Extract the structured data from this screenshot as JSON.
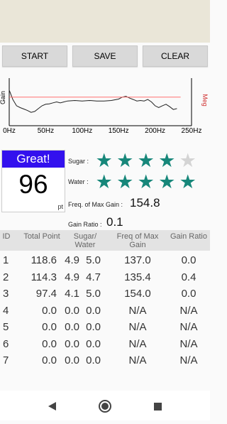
{
  "buttons": {
    "start": "START",
    "save": "SAVE",
    "clear": "CLEAR"
  },
  "chart_data": {
    "type": "line",
    "xlabel": "",
    "ylabel": "Gain",
    "ylabel_right": "Meg",
    "xlim": [
      0,
      250
    ],
    "x_ticks": [
      "0Hz",
      "50Hz",
      "100Hz",
      "150Hz",
      "200Hz",
      "250Hz"
    ],
    "series": [
      {
        "color": "#222222",
        "x": [
          0,
          5,
          10,
          15,
          20,
          25,
          30,
          35,
          40,
          45,
          50,
          55,
          60,
          65,
          70,
          75,
          80,
          90,
          100,
          110,
          120,
          130,
          140,
          150,
          155,
          160,
          165,
          170,
          175,
          180,
          185,
          190,
          195,
          200,
          205,
          210,
          215,
          220,
          225,
          230
        ],
        "y": [
          0.75,
          0.55,
          0.42,
          0.38,
          0.35,
          0.32,
          0.28,
          0.3,
          0.36,
          0.42,
          0.45,
          0.46,
          0.48,
          0.5,
          0.48,
          0.5,
          0.52,
          0.53,
          0.52,
          0.53,
          0.52,
          0.52,
          0.53,
          0.56,
          0.6,
          0.62,
          0.58,
          0.55,
          0.52,
          0.53,
          0.52,
          0.55,
          0.5,
          0.42,
          0.38,
          0.42,
          0.45,
          0.4,
          0.34,
          0.36
        ]
      },
      {
        "color": "#ff6f6f",
        "x": [
          0,
          235
        ],
        "y": [
          0.6,
          0.6
        ]
      }
    ]
  },
  "result": {
    "rating": "Great!",
    "score": "96",
    "unit": "pt"
  },
  "labels": {
    "sugar": "Sugar :",
    "water": "Water :",
    "freq": "Freq. of Max Gain :",
    "ratio": "Gain Ratio :"
  },
  "values": {
    "freq": "154.8",
    "ratio": "0.1"
  },
  "stars": {
    "sugar": 4,
    "water": 5,
    "max": 5,
    "color_on": "#17877a",
    "color_off": "#d4d4d4"
  },
  "table": {
    "headers": [
      "ID",
      "Total Point",
      "Sugar/ Water",
      "Freq of Max Gain",
      "Gain Ratio"
    ],
    "rows": [
      [
        "1",
        "118.6",
        "4.9",
        "5.0",
        "137.0",
        "0.0"
      ],
      [
        "2",
        "114.3",
        "4.9",
        "4.7",
        "135.4",
        "0.4"
      ],
      [
        "3",
        "97.4",
        "4.1",
        "5.0",
        "154.0",
        "0.0"
      ],
      [
        "4",
        "0.0",
        "0.0",
        "0.0",
        "N/A",
        "N/A"
      ],
      [
        "5",
        "0.0",
        "0.0",
        "0.0",
        "N/A",
        "N/A"
      ],
      [
        "6",
        "0.0",
        "0.0",
        "0.0",
        "N/A",
        "N/A"
      ],
      [
        "7",
        "0.0",
        "0.0",
        "0.0",
        "N/A",
        "N/A"
      ]
    ]
  },
  "nav": {
    "back": "back-icon",
    "home": "home-icon",
    "recents": "recents-icon"
  }
}
